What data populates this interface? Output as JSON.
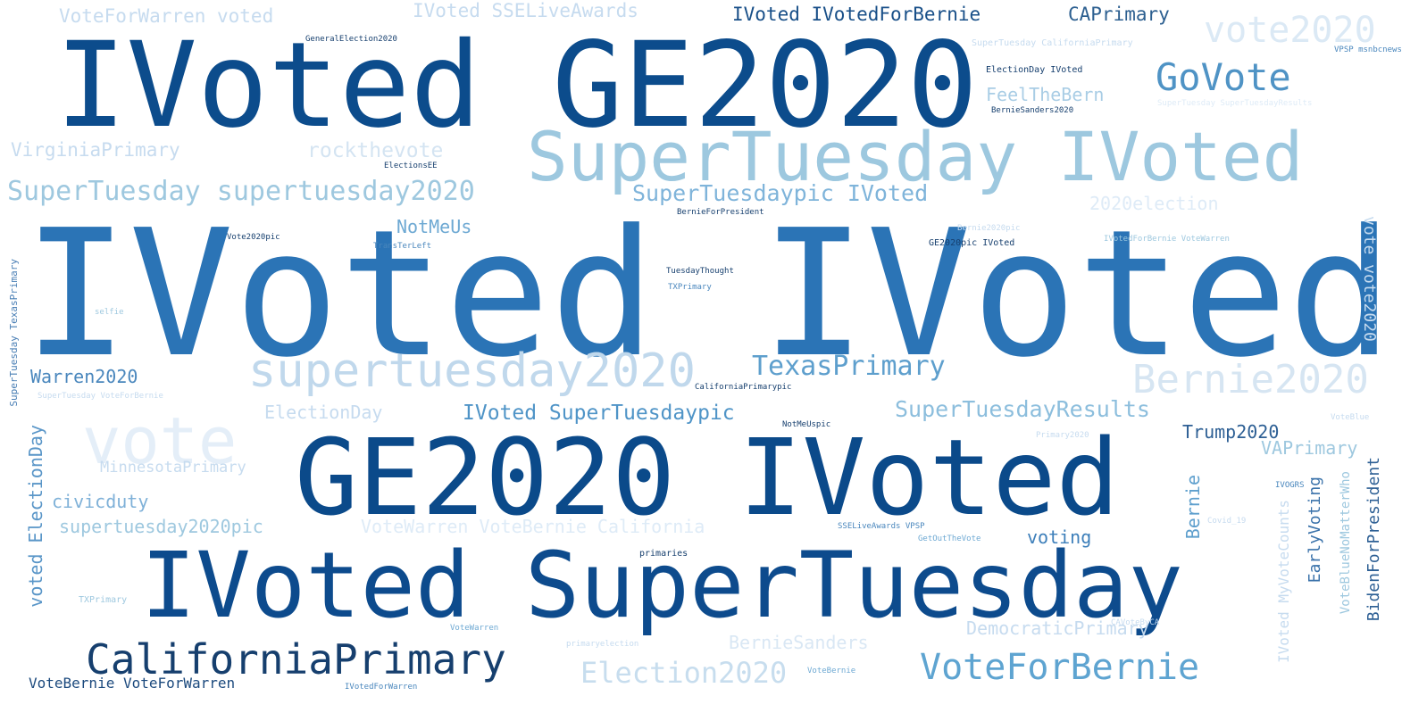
{
  "palette": {
    "c1": "#08306b",
    "c2": "#08519c",
    "c3": "#2171b5",
    "c4": "#4292c6",
    "c5": "#6baed6",
    "c6": "#9ecae1",
    "c7": "#c6dbef",
    "c8": "#deebf7"
  },
  "words": [
    {
      "text": "IVoted IVoted",
      "color": "#2b74b6"
    },
    {
      "text": "IVoted GE2020",
      "color": "#0c4c8c"
    },
    {
      "text": "GE2020 IVoted",
      "color": "#0b4a8a"
    },
    {
      "text": "IVoted SuperTuesday",
      "color": "#0d4b8d"
    },
    {
      "text": "SuperTuesday IVoted",
      "color": "#9dc8df"
    },
    {
      "text": "supertuesday2020",
      "color": "#c0d8ec"
    },
    {
      "text": "vote",
      "color": "#e4eef8"
    },
    {
      "text": "CaliforniaPrimary",
      "color": "#163f6e"
    },
    {
      "text": "VoteForBernie",
      "color": "#5ea4d1"
    },
    {
      "text": "Bernie2020",
      "color": "#d6e5f2"
    },
    {
      "text": "vote2020",
      "color": "#dbe9f5"
    },
    {
      "text": "GoVote",
      "color": "#4f93c5"
    },
    {
      "text": "SuperTuesday supertuesday2020",
      "color": "#9ec8df"
    },
    {
      "text": "TexasPrimary",
      "color": "#5e9fcd"
    },
    {
      "text": "Election2020",
      "color": "#c7ddee"
    },
    {
      "text": "SuperTuesdaypic IVoted",
      "color": "#7fb4da"
    },
    {
      "text": "SuperTuesdayResults",
      "color": "#8cbedd"
    },
    {
      "text": "IVoted SuperTuesdaypic",
      "color": "#4f94c7"
    },
    {
      "text": "VoteForWarren voted",
      "color": "#c6dbef"
    },
    {
      "text": "IVoted IVotedForBernie",
      "color": "#184f88"
    },
    {
      "text": "CAPrimary",
      "color": "#2c5f90"
    },
    {
      "text": "IVoted SSELiveAwards",
      "color": "#c6dbef"
    },
    {
      "text": "VirginiaPrimary",
      "color": "#c6dbef"
    },
    {
      "text": "rockthevote",
      "color": "#d4e4f2"
    },
    {
      "text": "FeelTheBern",
      "color": "#a9cde5"
    },
    {
      "text": "NotMeUs",
      "color": "#6ea9d3"
    },
    {
      "text": "2020election",
      "color": "#deebf7"
    },
    {
      "text": "Warren2020",
      "color": "#4a87bd"
    },
    {
      "text": "ElectionDay",
      "color": "#c6dbef"
    },
    {
      "text": "MinnesotaPrimary",
      "color": "#c6dbef"
    },
    {
      "text": "civicduty",
      "color": "#7fb1d8"
    },
    {
      "text": "supertuesday2020pic",
      "color": "#9ec8df"
    },
    {
      "text": "VoteWarren VoteBernie California",
      "color": "#deebf7"
    },
    {
      "text": "voting",
      "color": "#3d7fba"
    },
    {
      "text": "BernieSanders",
      "color": "#d9e7f4"
    },
    {
      "text": "DemocraticPrimary",
      "color": "#c6dbef"
    },
    {
      "text": "Trump2020",
      "color": "#2d5f94"
    },
    {
      "text": "VAPrimary",
      "color": "#9ec8df"
    },
    {
      "text": "VoteBernie VoteForWarren",
      "color": "#1c4a7e"
    },
    {
      "text": "voted ElectionDay",
      "color": "#5a96c8"
    },
    {
      "text": "SuperTuesday TexasPrimary",
      "color": "#4a7fb5"
    },
    {
      "text": "Bernie",
      "color": "#5e9fcd"
    },
    {
      "text": "EarlyVoting",
      "color": "#3a72aa"
    },
    {
      "text": "BidenForPresident",
      "color": "#2d5f94"
    },
    {
      "text": "IVoted MyVoteCounts",
      "color": "#c6dbef"
    },
    {
      "text": "VoteBlueNoMatterWho",
      "color": "#9ec8df"
    },
    {
      "text": "vote vote2020",
      "color": "#c6dbef"
    },
    {
      "text": "GeneralElection2020",
      "color": "#163f6e"
    },
    {
      "text": "ElectionDay IVoted",
      "color": "#163f6e"
    },
    {
      "text": "BernieSanders2020",
      "color": "#163f6e"
    },
    {
      "text": "ElectionsEE",
      "color": "#163f6e"
    },
    {
      "text": "BernieForPresident",
      "color": "#163f6e"
    },
    {
      "text": "Vote2020pic",
      "color": "#163f6e"
    },
    {
      "text": "TransTerLeft",
      "color": "#4a87bd"
    },
    {
      "text": "GE2020pic IVoted",
      "color": "#163f6e"
    },
    {
      "text": "TuesdayThought",
      "color": "#163f6e"
    },
    {
      "text": "TXPrimary",
      "color": "#4a87bd"
    },
    {
      "text": "CaliforniaPrimarypic",
      "color": "#163f6e"
    },
    {
      "text": "NotMeUspic",
      "color": "#163f6e"
    },
    {
      "text": "SSELiveAwards VPSP",
      "color": "#4a87bd"
    },
    {
      "text": "GetOutTheVote",
      "color": "#6ea9d3"
    },
    {
      "text": "primaries",
      "color": "#163f6e"
    },
    {
      "text": "VoteBernie",
      "color": "#6ea9d3"
    },
    {
      "text": "IVotedForWarren",
      "color": "#4a87bd"
    },
    {
      "text": "VoteWarren",
      "color": "#6ea9d3"
    },
    {
      "text": "SuperTuesday CaliforniaPrimary",
      "color": "#c6dbef"
    },
    {
      "text": "VPSP msnbcnews",
      "color": "#4a87bd"
    },
    {
      "text": "IVotedForBernie VoteWarren",
      "color": "#9ec8df"
    },
    {
      "text": "Bernie2020pic",
      "color": "#c6dbef"
    },
    {
      "text": "SuperTuesday VoteForBernie",
      "color": "#c6dbef"
    },
    {
      "text": "selfie",
      "color": "#9ec8df"
    },
    {
      "text": "Primary2020",
      "color": "#c6dbef"
    },
    {
      "text": "Covid_19",
      "color": "#c6dbef"
    },
    {
      "text": "TXPrimary",
      "color": "#9ec8df"
    },
    {
      "text": "primaryelection",
      "color": "#c6dbef"
    },
    {
      "text": "CAVoteByCA",
      "color": "#c6dbef"
    },
    {
      "text": "VoteBlue",
      "color": "#c6dbef"
    },
    {
      "text": "IVOGRS",
      "color": "#4a87bd"
    },
    {
      "text": "SuperTuesday SuperTuesdayResults",
      "color": "#deebf7"
    }
  ]
}
